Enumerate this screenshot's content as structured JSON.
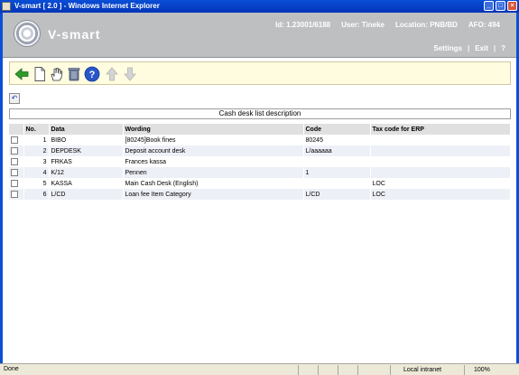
{
  "window": {
    "title": "V-smart [ 2.0 ] - Windows Internet Explorer"
  },
  "header": {
    "brand": "V-smart",
    "id_label": "Id: 1.23001/6188",
    "user_label": "User: Tineke",
    "location_label": "Location: PNB/BD",
    "afo_label": "AFO: 494",
    "settings": "Settings",
    "exit": "Exit",
    "help": "?"
  },
  "page": {
    "caption": "Cash desk list description"
  },
  "table": {
    "headers": {
      "no": "No.",
      "data": "Data",
      "wording": "Wording",
      "code": "Code",
      "tax": "Tax code for ERP"
    },
    "rows": [
      {
        "no": "1",
        "data": "BIBO",
        "wording": "[80245]Book fines",
        "code": "80245",
        "tax": ""
      },
      {
        "no": "2",
        "data": "DEPDESK",
        "wording": "Deposit account desk",
        "code": "L/aaaaaa",
        "tax": ""
      },
      {
        "no": "3",
        "data": "FRKAS",
        "wording": "Frances kassa",
        "code": "",
        "tax": ""
      },
      {
        "no": "4",
        "data": "K/12",
        "wording": "Pennen",
        "code": "1",
        "tax": ""
      },
      {
        "no": "5",
        "data": "KASSA",
        "wording": "Main Cash Desk (English)",
        "code": "",
        "tax": "LOC"
      },
      {
        "no": "6",
        "data": "L/CD",
        "wording": "Loan fee Item Category",
        "code": "L/CD",
        "tax": "LOC"
      }
    ]
  },
  "status": {
    "done": "Done",
    "zone": "Local intranet",
    "zoom": "100%"
  }
}
